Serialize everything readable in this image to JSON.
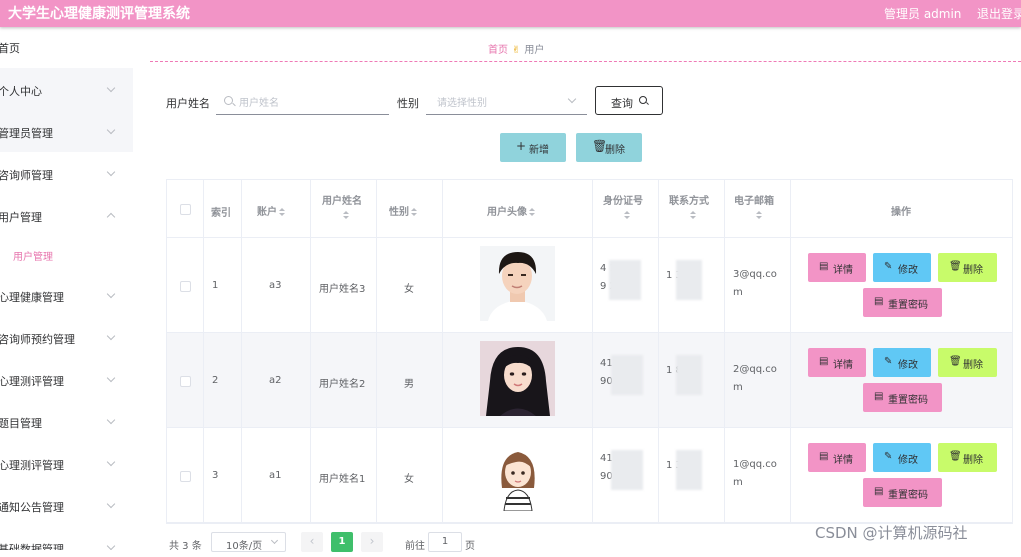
{
  "app": {
    "title": "大学生心理健康测评管理系统",
    "admin_label": "管理员 admin",
    "logout": "退出登录"
  },
  "sidebar": {
    "items": [
      {
        "label": "首页",
        "has_arrow": false
      },
      {
        "label": "个人中心",
        "has_arrow": true
      },
      {
        "label": "管理员管理",
        "has_arrow": true
      },
      {
        "label": "咨询师管理",
        "has_arrow": true
      },
      {
        "label": "用户管理",
        "has_arrow": true,
        "expanded": true
      },
      {
        "label": "心理健康管理",
        "has_arrow": true
      },
      {
        "label": "咨询师预约管理",
        "has_arrow": true
      },
      {
        "label": "心理测评管理",
        "has_arrow": true
      },
      {
        "label": "题目管理",
        "has_arrow": true
      },
      {
        "label": "心理测评管理",
        "has_arrow": true
      },
      {
        "label": "通知公告管理",
        "has_arrow": true
      },
      {
        "label": "基础数据管理",
        "has_arrow": true
      }
    ],
    "active_sub_item": "用户管理"
  },
  "breadcrumb": {
    "home": "首页",
    "current": "用户"
  },
  "search": {
    "name_label": "用户姓名",
    "name_placeholder": "用户姓名",
    "gender_label": "性别",
    "gender_placeholder": "请选择性别",
    "query_button": "查询"
  },
  "actions": {
    "add": "新增",
    "delete": "删除"
  },
  "table": {
    "headers": {
      "index": "索引",
      "account": "账户",
      "name": "用户姓名",
      "gender": "性别",
      "avatar": "用户头像",
      "id_number": "身份证号",
      "phone": "联系方式",
      "email": "电子邮箱",
      "operations": "操作"
    },
    "rows": [
      {
        "index": "1",
        "account": "a3",
        "name": "用户姓名3",
        "gender": "女",
        "id_line1": "4 19",
        "id_line2": "9 20",
        "phone": "1 36",
        "email_line1": "3@qq.co",
        "email_line2": "m",
        "avatar": "young-man-photo"
      },
      {
        "index": "2",
        "account": "a2",
        "name": "用户姓名2",
        "gender": "男",
        "id_line1": "41 9",
        "id_line2": "90 0",
        "phone": "1 86",
        "email_line1": "2@qq.co",
        "email_line2": "m",
        "avatar": "young-woman-photo"
      },
      {
        "index": "3",
        "account": "a1",
        "name": "用户姓名1",
        "gender": "女",
        "id_line1": "41( 9",
        "id_line2": "90: 0",
        "phone": "1 36",
        "email_line1": "1@qq.co",
        "email_line2": "m",
        "avatar": "cartoon-girl-illustration"
      }
    ],
    "row_actions": {
      "detail": "详情",
      "edit": "修改",
      "delete": "删除",
      "reset_password": "重置密码"
    }
  },
  "pagination": {
    "total": "共 3 条",
    "page_size": "10条/页",
    "current_page": "1",
    "goto_label": "前往",
    "goto_value": "1",
    "page_suffix": "页",
    "prev_icon": "chevron-left-icon",
    "next_icon": "chevron-right-icon"
  },
  "watermark": "CSDN @计算机源码社",
  "colors": {
    "header": "#f294c6",
    "accent_pink": "#e776ae",
    "teal_button": "#90d3dc",
    "edit_blue": "#60c8f5",
    "delete_green": "#c8fb6a",
    "active_page": "#3fbf6b"
  }
}
